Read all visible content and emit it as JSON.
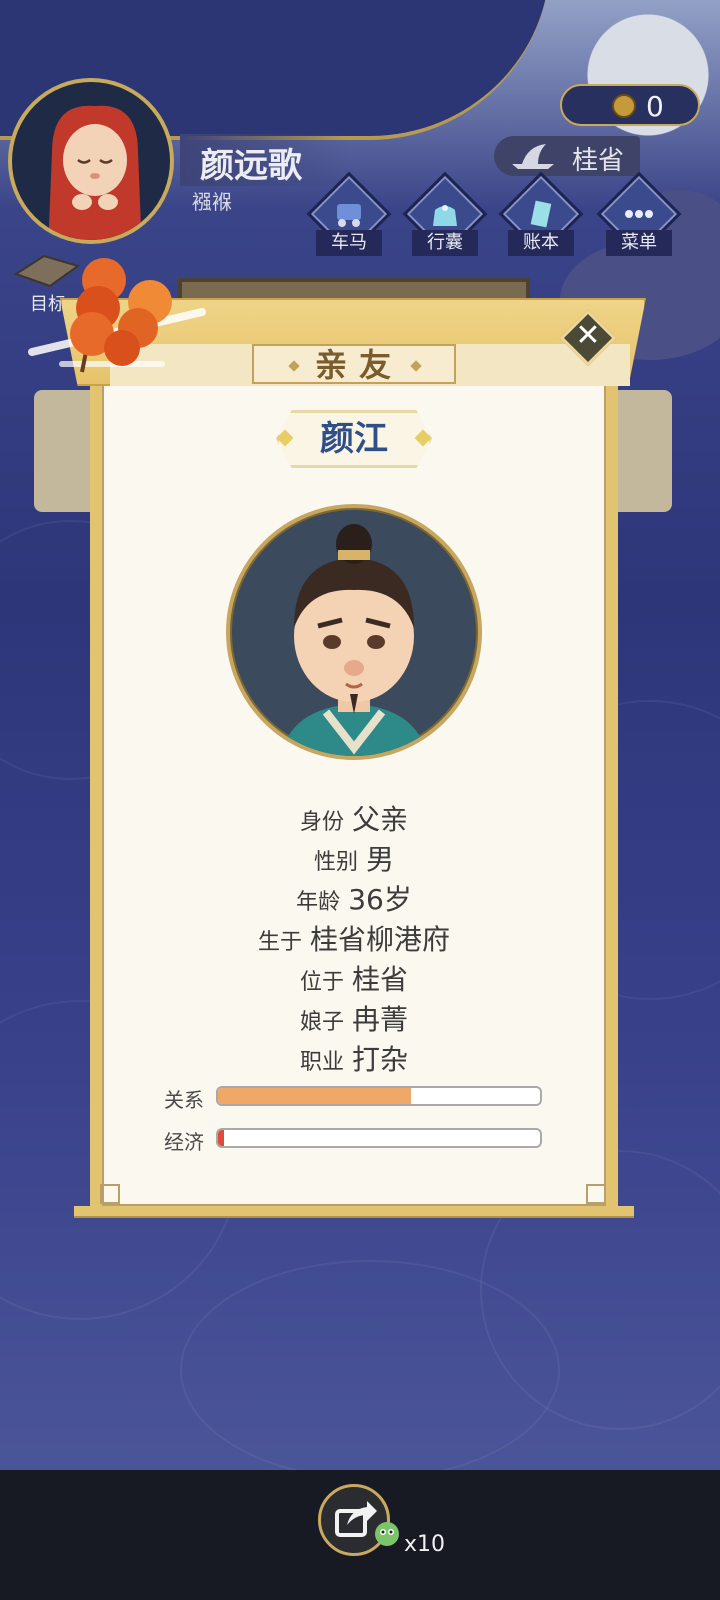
{
  "player": {
    "name": "颜远歌",
    "stage": "襁褓"
  },
  "hud": {
    "coins": "0",
    "location": "桂省",
    "goal_label": "目标",
    "nav": [
      {
        "label": "车马",
        "icon": "carriage-icon"
      },
      {
        "label": "行囊",
        "icon": "bag-icon"
      },
      {
        "label": "账本",
        "icon": "ledger-icon"
      },
      {
        "label": "菜单",
        "icon": "menu-icon"
      }
    ]
  },
  "dialog": {
    "title": "亲友",
    "person_name": "颜江",
    "fields": [
      {
        "key": "身份",
        "value": "父亲"
      },
      {
        "key": "性别",
        "value": "男"
      },
      {
        "key": "年龄",
        "value": "36岁"
      },
      {
        "key": "生于",
        "value": "桂省柳港府"
      },
      {
        "key": "位于",
        "value": "桂省"
      },
      {
        "key": "娘子",
        "value": "冉菁"
      },
      {
        "key": "职业",
        "value": "打杂"
      }
    ],
    "bars": [
      {
        "label": "关系",
        "level": 0.6,
        "color": "#f0a868"
      },
      {
        "label": "经济",
        "level": 0.02,
        "color": "#e04a3a"
      }
    ],
    "close_icon": "close-icon"
  },
  "bottom": {
    "share_count": "x10",
    "share_icon": "share-icon"
  }
}
